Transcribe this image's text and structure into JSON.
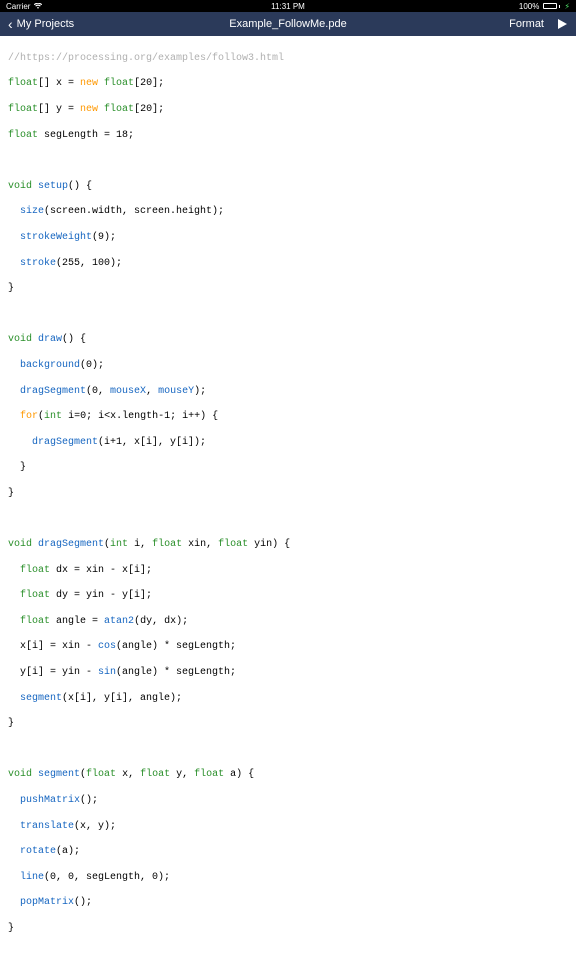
{
  "status": {
    "carrier": "Carrier",
    "wifi": "📶",
    "time": "11:31 PM",
    "battery_pct": "100%"
  },
  "nav": {
    "back_label": "My Projects",
    "title": "Example_FollowMe.pde",
    "format_label": "Format"
  },
  "code": {
    "l1": "//https://processing.org/examples/follow3.html",
    "l2a": "float",
    "l2b": "[] x = ",
    "l2c": "new",
    "l2d": " float",
    "l2e": "[20];",
    "l3a": "float",
    "l3b": "[] y = ",
    "l3c": "new",
    "l3d": " float",
    "l3e": "[20];",
    "l4a": "float",
    "l4b": " segLength = 18;",
    "blank1": "",
    "l5a": "void",
    "l5b": " setup",
    "l5c": "() {",
    "l6a": "  ",
    "l6b": "size",
    "l6c": "(screen.width, screen.height);",
    "l7a": "  ",
    "l7b": "strokeWeight",
    "l7c": "(9);",
    "l8a": "  ",
    "l8b": "stroke",
    "l8c": "(255, 100);",
    "l9": "}",
    "blank2": "",
    "l10a": "void",
    "l10b": " draw",
    "l10c": "() {",
    "l11a": "  ",
    "l11b": "background",
    "l11c": "(0);",
    "l12a": "  ",
    "l12b": "dragSegment",
    "l12c": "(0, ",
    "l12d": "mouseX",
    "l12e": ", ",
    "l12f": "mouseY",
    "l12g": ");",
    "l13a": "  ",
    "l13b": "for",
    "l13c": "(",
    "l13d": "int",
    "l13e": " i=0; i<x.length-1; i++) {",
    "l14a": "    ",
    "l14b": "dragSegment",
    "l14c": "(i+1, x[i], y[i]);",
    "l15": "  }",
    "l16": "}",
    "blank3": "",
    "l17a": "void",
    "l17b": " dragSegment",
    "l17c": "(",
    "l17d": "int",
    "l17e": " i, ",
    "l17f": "float",
    "l17g": " xin, ",
    "l17h": "float",
    "l17i": " yin) {",
    "l18a": "  ",
    "l18b": "float",
    "l18c": " dx = xin - x[i];",
    "l19a": "  ",
    "l19b": "float",
    "l19c": " dy = yin - y[i];",
    "l20a": "  ",
    "l20b": "float",
    "l20c": " angle = ",
    "l20d": "atan2",
    "l20e": "(dy, dx);",
    "l21a": "  x[i] = xin - ",
    "l21b": "cos",
    "l21c": "(angle) * segLength;",
    "l22a": "  y[i] = yin - ",
    "l22b": "sin",
    "l22c": "(angle) * segLength;",
    "l23a": "  ",
    "l23b": "segment",
    "l23c": "(x[i], y[i], angle);",
    "l24": "}",
    "blank4": "",
    "l25a": "void",
    "l25b": " segment",
    "l25c": "(",
    "l25d": "float",
    "l25e": " x, ",
    "l25f": "float",
    "l25g": " y, ",
    "l25h": "float",
    "l25i": " a) {",
    "l26a": "  ",
    "l26b": "pushMatrix",
    "l26c": "();",
    "l27a": "  ",
    "l27b": "translate",
    "l27c": "(x, y);",
    "l28a": "  ",
    "l28b": "rotate",
    "l28c": "(a);",
    "l29a": "  ",
    "l29b": "line",
    "l29c": "(0, 0, segLength, 0);",
    "l30a": "  ",
    "l30b": "popMatrix",
    "l30c": "();",
    "l31": "}"
  }
}
